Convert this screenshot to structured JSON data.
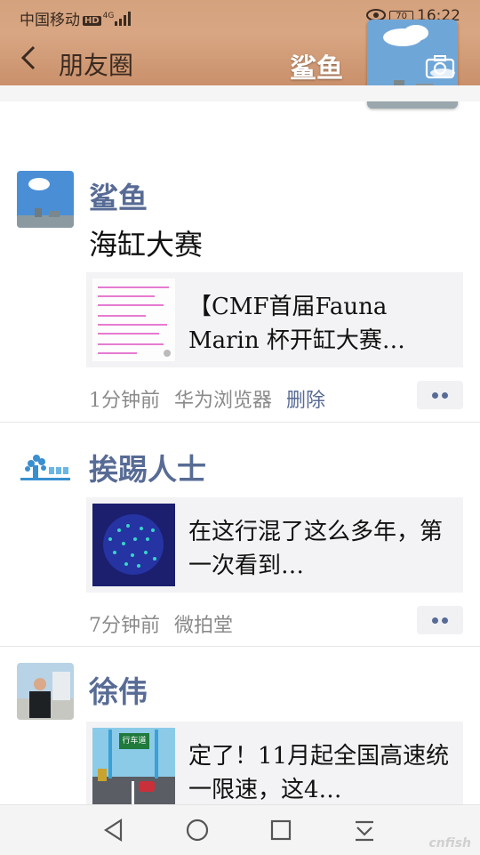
{
  "status_bar": {
    "carrier": "中国移动",
    "hd_badge": "HD",
    "network": "4G",
    "battery": "70",
    "time": "16:22"
  },
  "nav": {
    "title": "朋友圈",
    "profile_name": "鲨鱼"
  },
  "posts": [
    {
      "author": "鲨鱼",
      "text": "海缸大赛",
      "link_text": "【CMF首届Fauna Marin 杯开缸大赛…",
      "time": "1分钟前",
      "source": "华为浏览器",
      "delete_label": "删除"
    },
    {
      "author": "挨踢人士",
      "link_text": "在这行混了这么多年，第一次看到…",
      "time": "7分钟前",
      "source": "微拍堂"
    },
    {
      "author": "徐伟",
      "link_text": "定了！11月起全国高速统一限速，这4…",
      "thumb_sign": "行车道"
    }
  ],
  "watermark": "cnfish"
}
